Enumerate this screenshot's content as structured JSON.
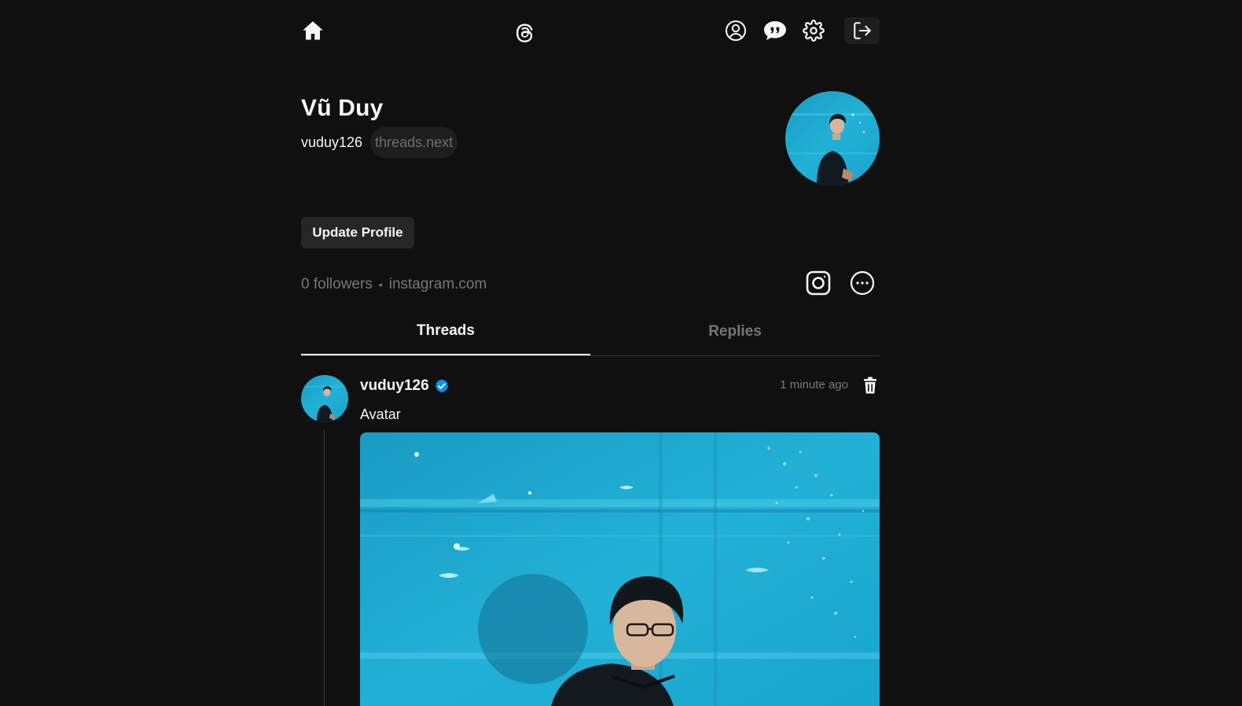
{
  "nav": {
    "home_icon": "home-icon",
    "logo_icon": "threads-logo-icon",
    "profile_icon": "user-circle-icon",
    "chat_icon": "chat-bubbles-icon",
    "settings_icon": "gear-icon",
    "logout_icon": "logout-icon"
  },
  "profile": {
    "name": "Vũ Duy",
    "username": "vuduy126",
    "domain_pill": "threads.next",
    "update_button": "Update Profile",
    "followers": "0 followers",
    "separator": "•",
    "link": "instagram.com"
  },
  "tabs": [
    {
      "label": "Threads",
      "active": true
    },
    {
      "label": "Replies",
      "active": false
    }
  ],
  "post": {
    "username": "vuduy126",
    "verified": true,
    "time": "1 minute ago",
    "text": "Avatar"
  },
  "colors": {
    "background": "#101010",
    "text": "#f3f5f7",
    "muted": "#777777",
    "verified": "#0095f6",
    "aquarium": "#1fa8cf"
  }
}
